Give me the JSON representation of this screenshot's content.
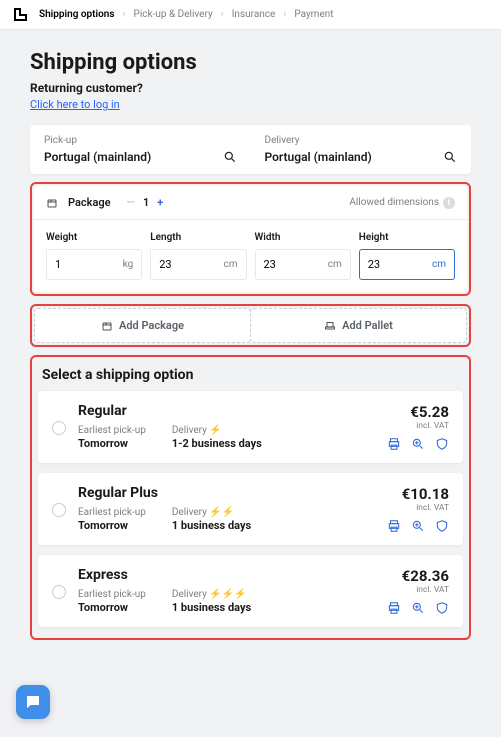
{
  "breadcrumbs": {
    "b0": "Shipping options",
    "b1": "Pick-up & Delivery",
    "b2": "Insurance",
    "b3": "Payment"
  },
  "page": {
    "heading": "Shipping options",
    "returning": "Returning customer?",
    "login_link": "Click here to log in"
  },
  "loc": {
    "pickup_label": "Pick-up",
    "pickup_value": "Portugal (mainland)",
    "delivery_label": "Delivery",
    "delivery_value": "Portugal (mainland)"
  },
  "pkg": {
    "title": "Package",
    "qty": "1",
    "allowed": "Allowed dimensions",
    "weight_label": "Weight",
    "weight_value": "1",
    "weight_unit": "kg",
    "length_label": "Length",
    "length_value": "23",
    "length_unit": "cm",
    "width_label": "Width",
    "width_value": "23",
    "width_unit": "cm",
    "height_label": "Height",
    "height_value": "23",
    "height_unit": "cm"
  },
  "add": {
    "package": "Add Package",
    "pallet": "Add Pallet"
  },
  "select_title": "Select a shipping option",
  "opts": {
    "pickup_label": "Earliest pick-up",
    "delivery_label": "Delivery",
    "vat": "incl. VAT",
    "o0": {
      "name": "Regular",
      "pickup": "Tomorrow",
      "delivery": "1-2 business days",
      "price": "€5.28"
    },
    "o1": {
      "name": "Regular Plus",
      "pickup": "Tomorrow",
      "delivery": "1 business days",
      "price": "€10.18"
    },
    "o2": {
      "name": "Express",
      "pickup": "Tomorrow",
      "delivery": "1 business days",
      "price": "€28.36"
    }
  }
}
